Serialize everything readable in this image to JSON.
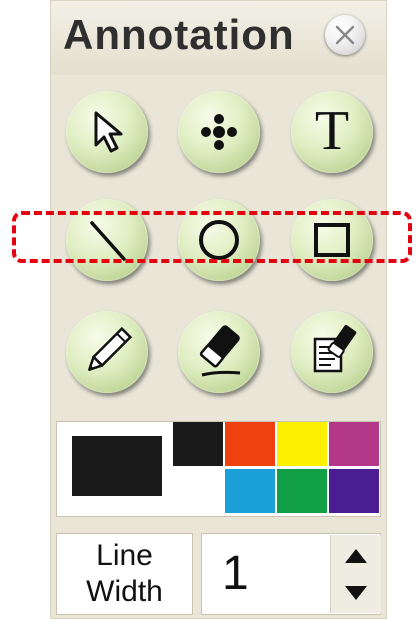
{
  "header": {
    "title": "Annotation",
    "close_icon": "close-icon"
  },
  "tools": [
    {
      "name": "select",
      "icon": "cursor-arrow-icon"
    },
    {
      "name": "move",
      "icon": "move-dots-icon"
    },
    {
      "name": "text",
      "icon": "text-t-icon",
      "glyph": "T"
    },
    {
      "name": "line",
      "icon": "line-icon"
    },
    {
      "name": "ellipse",
      "icon": "circle-icon"
    },
    {
      "name": "rectangle",
      "icon": "square-icon"
    },
    {
      "name": "pen",
      "icon": "pencil-icon"
    },
    {
      "name": "eraser",
      "icon": "eraser-icon"
    },
    {
      "name": "clear",
      "icon": "clear-page-icon"
    }
  ],
  "palette": {
    "current_color": "#1a1a1a",
    "swatches": [
      "#1a1a1a",
      "#ef4010",
      "#fff000",
      "#b4388a",
      "#ffffff",
      "#1a9fd8",
      "#11a046",
      "#4a1e92"
    ]
  },
  "line_width": {
    "label_line1": "Line",
    "label_line2": "Width",
    "value": "1",
    "up_icon": "triangle-up-icon",
    "down_icon": "triangle-down-icon"
  },
  "highlight": {
    "color": "#e3000f",
    "style": "dashed"
  }
}
